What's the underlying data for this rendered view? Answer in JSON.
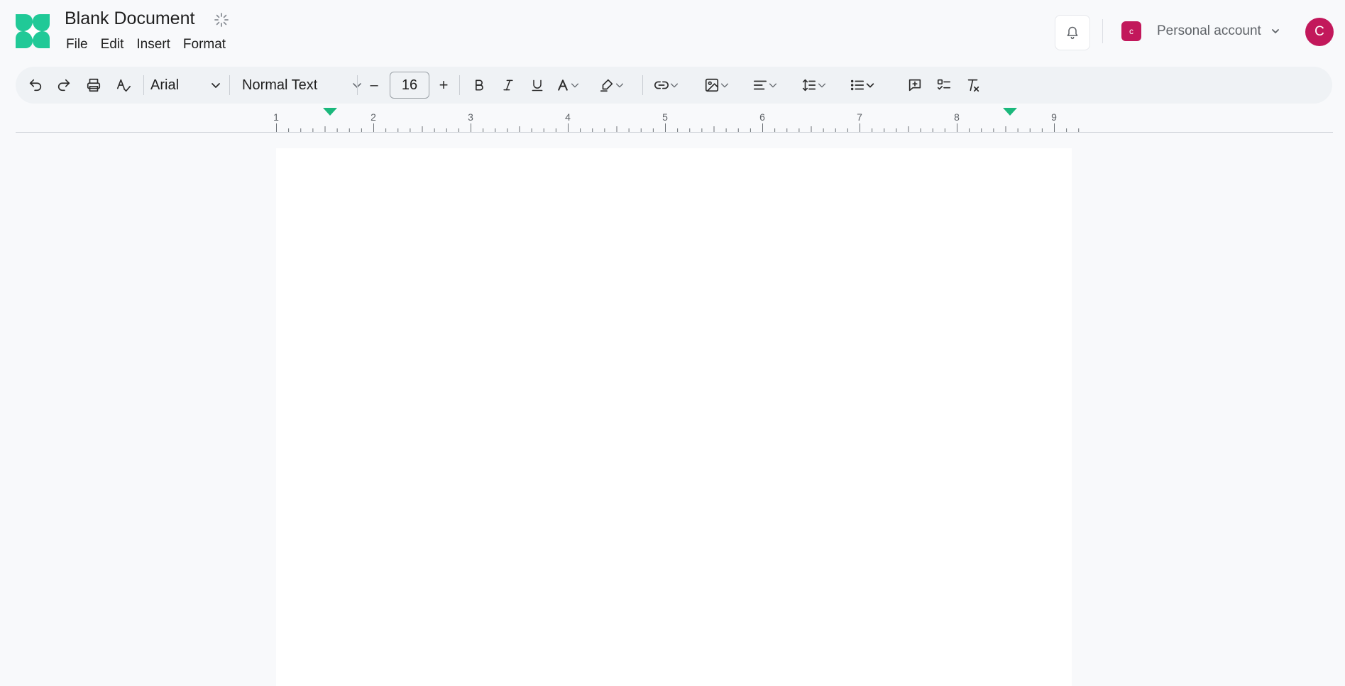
{
  "header": {
    "doc_title": "Blank Document",
    "menu": [
      "File",
      "Edit",
      "Insert",
      "Format"
    ],
    "account_badge": "c",
    "account_name": "Personal account",
    "avatar_initial": "C"
  },
  "toolbar": {
    "font_family": "Arial",
    "text_style": "Normal Text",
    "font_size": "16",
    "decrease_label": "–",
    "increase_label": "+"
  },
  "ruler": {
    "numbers": [
      "1",
      "2",
      "3",
      "4",
      "5",
      "6",
      "7",
      "8",
      "9"
    ]
  },
  "icons": {
    "logo": "logo-icon",
    "sync": "loading-spinner-icon",
    "notifications": "bell-icon",
    "account_menu": "chevron-down-icon"
  },
  "colors": {
    "brand": "#20c997",
    "avatar": "#c2185b",
    "indent_marker": "#1bb87c",
    "background": "#f8f9fb",
    "toolbar": "#eff2f5"
  }
}
